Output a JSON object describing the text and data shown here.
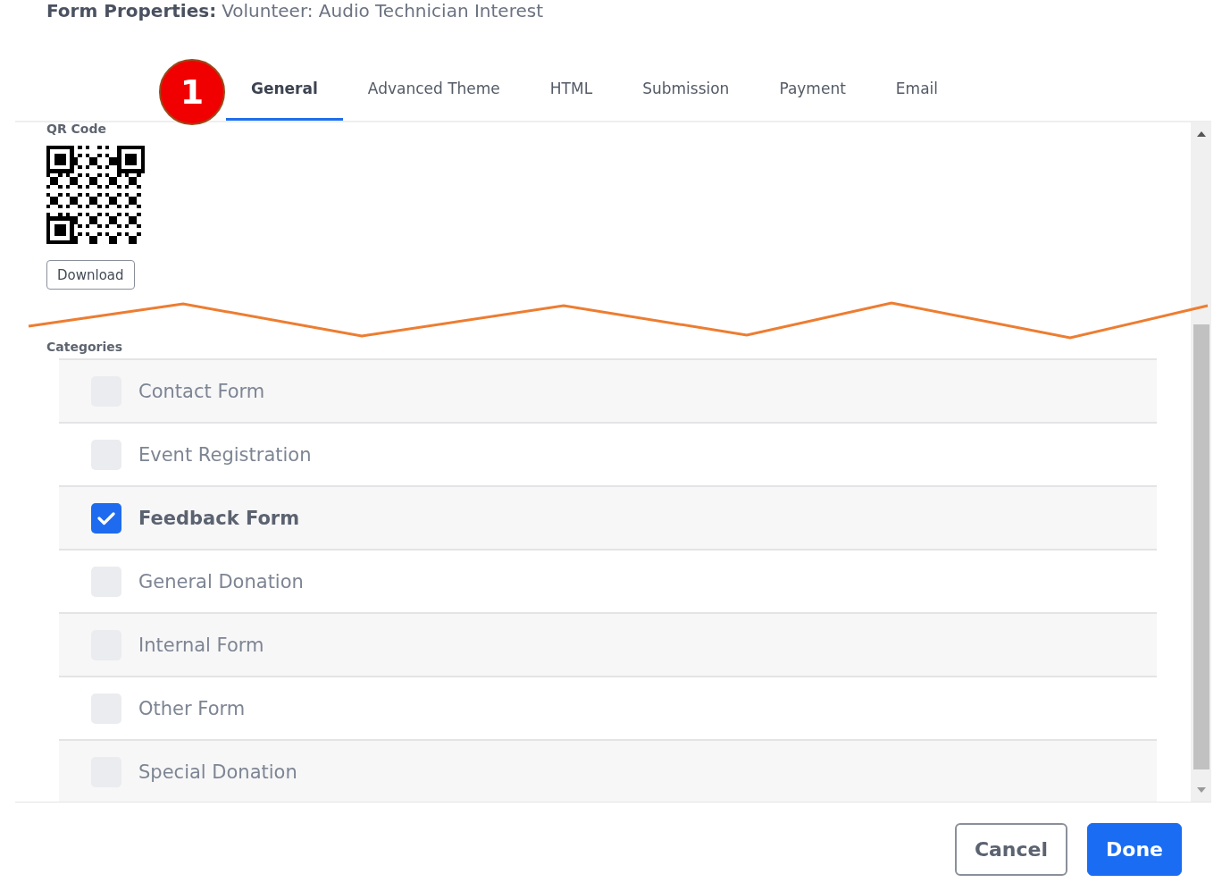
{
  "header": {
    "label": "Form Properties:",
    "title": "Volunteer: Audio Technician Interest"
  },
  "tabs": [
    {
      "label": "General",
      "selected": true
    },
    {
      "label": "Advanced Theme",
      "selected": false
    },
    {
      "label": "HTML",
      "selected": false
    },
    {
      "label": "Submission",
      "selected": false
    },
    {
      "label": "Payment",
      "selected": false
    },
    {
      "label": "Email",
      "selected": false
    }
  ],
  "step_badge": "1",
  "qr_code": {
    "label": "QR Code",
    "button": "Download"
  },
  "categories": {
    "label": "Categories",
    "items": [
      {
        "label": "Contact Form",
        "checked": false
      },
      {
        "label": "Event Registration",
        "checked": false
      },
      {
        "label": "Feedback Form",
        "checked": true
      },
      {
        "label": "General Donation",
        "checked": false
      },
      {
        "label": "Internal Form",
        "checked": false
      },
      {
        "label": "Other Form",
        "checked": false
      },
      {
        "label": "Special Donation",
        "checked": false
      }
    ]
  },
  "buttons": {
    "cancel": "Cancel",
    "done": "Done"
  }
}
